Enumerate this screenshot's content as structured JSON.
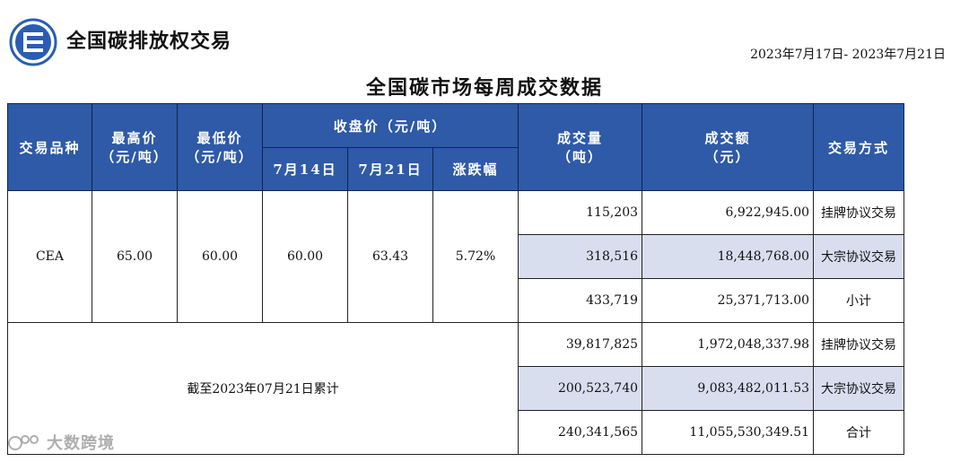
{
  "header": {
    "brand": "全国碳排放权交易",
    "date_range": "2023年7月17日- 2023年7月21日",
    "title": "全国碳市场每周成交数据"
  },
  "table": {
    "headers": {
      "product": "交易品种",
      "high_line1": "最高价",
      "high_line2": "（元/吨）",
      "low_line1": "最低价",
      "low_line2": "（元/吨）",
      "close_group": "收盘价（元/吨）",
      "close_prev": "7月14日",
      "close_curr": "7月21日",
      "change": "涨跌幅",
      "volume_line1": "成交量",
      "volume_line2": "（吨）",
      "amount_line1": "成交额",
      "amount_line2": "（元）",
      "method": "交易方式"
    },
    "weekly": {
      "product": "CEA",
      "high": "65.00",
      "low": "60.00",
      "close_prev": "60.00",
      "close_curr": "63.43",
      "change": "5.72%",
      "rows": [
        {
          "volume": "115,203",
          "amount": "6,922,945.00",
          "method": "挂牌协议交易"
        },
        {
          "volume": "318,516",
          "amount": "18,448,768.00",
          "method": "大宗协议交易"
        },
        {
          "volume": "433,719",
          "amount": "25,371,713.00",
          "method": "小计"
        }
      ]
    },
    "cumulative": {
      "label": "截至2023年07月21日累计",
      "rows": [
        {
          "volume": "39,817,825",
          "amount": "1,972,048,337.98",
          "method": "挂牌协议交易"
        },
        {
          "volume": "200,523,740",
          "amount": "9,083,482,011.53",
          "method": "大宗协议交易"
        },
        {
          "volume": "240,341,565",
          "amount": "11,055,530,349.51",
          "method": "合计"
        }
      ]
    }
  },
  "watermark": "大数跨境",
  "colors": {
    "header_bg": "#2e5aa8",
    "shade": "#d9deef",
    "logo": "#2a5db0"
  }
}
